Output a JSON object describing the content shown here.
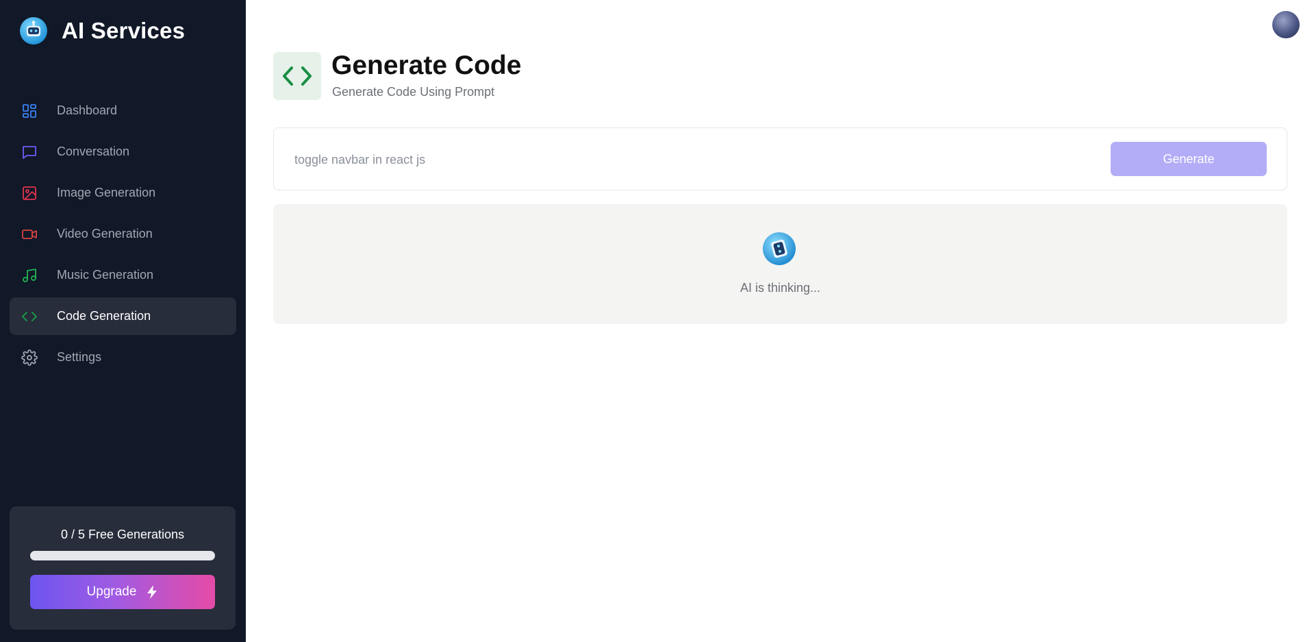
{
  "brand": {
    "name": "AI Services",
    "logo_icon": "robot-icon"
  },
  "sidebar": {
    "items": [
      {
        "label": "Dashboard",
        "icon": "dashboard-grid-icon",
        "color": "#3b82f6",
        "active": false
      },
      {
        "label": "Conversation",
        "icon": "chat-bubble-icon",
        "color": "#6d5bf5",
        "active": false
      },
      {
        "label": "Image Generation",
        "icon": "image-icon",
        "color": "#e1344f",
        "active": false
      },
      {
        "label": "Video Generation",
        "icon": "video-camera-icon",
        "color": "#d94444",
        "active": false
      },
      {
        "label": "Music Generation",
        "icon": "music-note-icon",
        "color": "#22b455",
        "active": false
      },
      {
        "label": "Code Generation",
        "icon": "code-brackets-icon",
        "color": "#1aa34a",
        "active": true
      },
      {
        "label": "Settings",
        "icon": "gear-icon",
        "color": "#a1a7b3",
        "active": false
      }
    ],
    "free_card": {
      "text": "0 / 5 Free Generations",
      "progress_fraction": 0,
      "upgrade_label": "Upgrade",
      "upgrade_icon": "lightning-bolt-icon"
    }
  },
  "header": {
    "avatar": "user-avatar"
  },
  "main": {
    "title": "Generate Code",
    "subtitle": "Generate Code Using Prompt",
    "title_icon": "code-brackets-icon",
    "prompt": {
      "placeholder": "toggle navbar in react js",
      "value": ""
    },
    "generate_label": "Generate",
    "thinking_text": "AI is thinking..."
  },
  "colors": {
    "sidebar_bg": "#111827",
    "active_item_bg": "#272d3a",
    "generate_button": "#b3adf7",
    "code_icon_green": "#1a8f44",
    "thinking_bg": "#f4f4f2"
  }
}
